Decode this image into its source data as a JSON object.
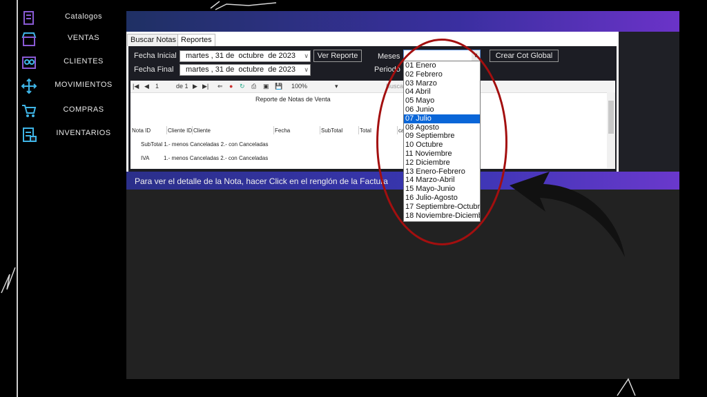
{
  "sidebar": {
    "items": [
      {
        "label": "Catalogos",
        "icon": "catalog-icon"
      },
      {
        "label": "VENTAS",
        "icon": "store-icon"
      },
      {
        "label": "CLIENTES",
        "icon": "customers-icon"
      },
      {
        "label": "MOVIMIENTOS",
        "icon": "move-icon"
      },
      {
        "label": "COMPRAS",
        "icon": "cart-icon"
      },
      {
        "label": "INVENTARIOS",
        "icon": "inventory-icon"
      }
    ]
  },
  "tabs": [
    {
      "label": "Buscar Notas"
    },
    {
      "label": "Reportes"
    }
  ],
  "filters": {
    "fecha_inicial_label": "Fecha Inicial",
    "fecha_final_label": "Fecha Final",
    "fecha_inicial_value": "martes , 31 de  octubre  de 2023",
    "fecha_final_value": "martes , 31 de  octubre  de 2023",
    "ver_reporte": "Ver Reporte",
    "meses_label": "Meses",
    "periodo_label": "Periodo",
    "crear_cot": "Crear Cot Global"
  },
  "report": {
    "toolbar": {
      "page": "1",
      "of": "de 1",
      "zoom": "100%",
      "search": "Buscar"
    },
    "title": "Reporte de Notas de Venta",
    "columns": [
      "Nota ID",
      "Cliente ID",
      "Cliente",
      "Fecha",
      "SubTotal",
      "Total",
      "ca"
    ],
    "subtotal_line": "SubTotal 1.- menos Canceladas 2.- con Canceladas",
    "iva_label": "IVA",
    "iva_line": "1.- menos Canceladas 2.- con Canceladas"
  },
  "status": "Para ver el detalle de la Nota, hacer Click en el renglón de la Factura",
  "meses_options": [
    "01 Enero",
    "02 Febrero",
    "03 Marzo",
    "04 Abril",
    "05 Mayo",
    "06 Junio",
    "07 Julio",
    "08 Agosto",
    "09 Septiembre",
    "10 Octubre",
    "11 Noviembre",
    "12 Diciembre",
    "13 Enero-Febrero",
    "14 Marzo-Abril",
    "15 Mayo-Junio",
    "16 Julio-Agosto",
    "17 Septiembre-Octubre",
    "18 Noviembre-Diciembre"
  ],
  "meses_selected": "07 Julio",
  "colors": {
    "accent": "#0a66d8",
    "annotation": "#a30f0f",
    "sidebar_icon": "#3fb6e8"
  }
}
